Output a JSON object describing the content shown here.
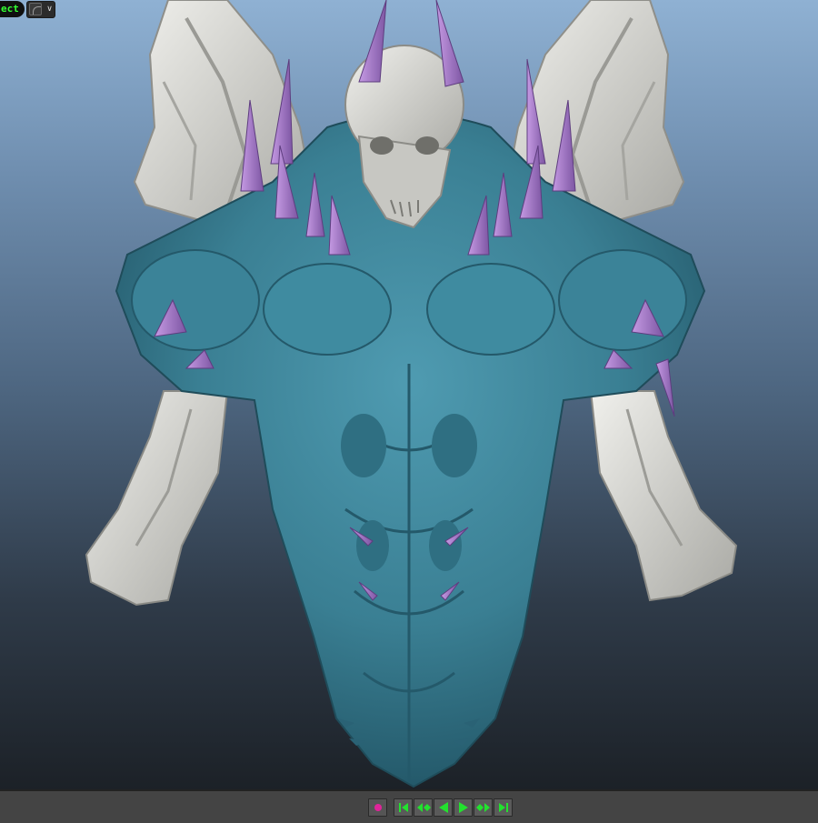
{
  "hud": {
    "camera_label": "ect",
    "camera_icon": "camera-icon",
    "dropdown_icon": "chevron-down-icon"
  },
  "playback": {
    "buttons": [
      {
        "name": "auto-key-button",
        "icon": "record-dot-icon"
      },
      {
        "name": "go-to-start-button",
        "icon": "skip-to-start-icon"
      },
      {
        "name": "step-back-key-button",
        "icon": "step-back-key-icon"
      },
      {
        "name": "play-backwards-button",
        "icon": "play-backwards-icon"
      },
      {
        "name": "play-forwards-button",
        "icon": "play-forwards-icon"
      },
      {
        "name": "step-forward-key-button",
        "icon": "step-forward-key-icon"
      },
      {
        "name": "go-to-end-button",
        "icon": "skip-to-end-icon"
      }
    ]
  },
  "colors": {
    "armor": "#3a7f93",
    "bone": "#d4d4d0",
    "spike": "#a479c6",
    "hud_text": "#33ff33",
    "transport_green": "#22e22e",
    "record_magenta": "#e0249a"
  }
}
